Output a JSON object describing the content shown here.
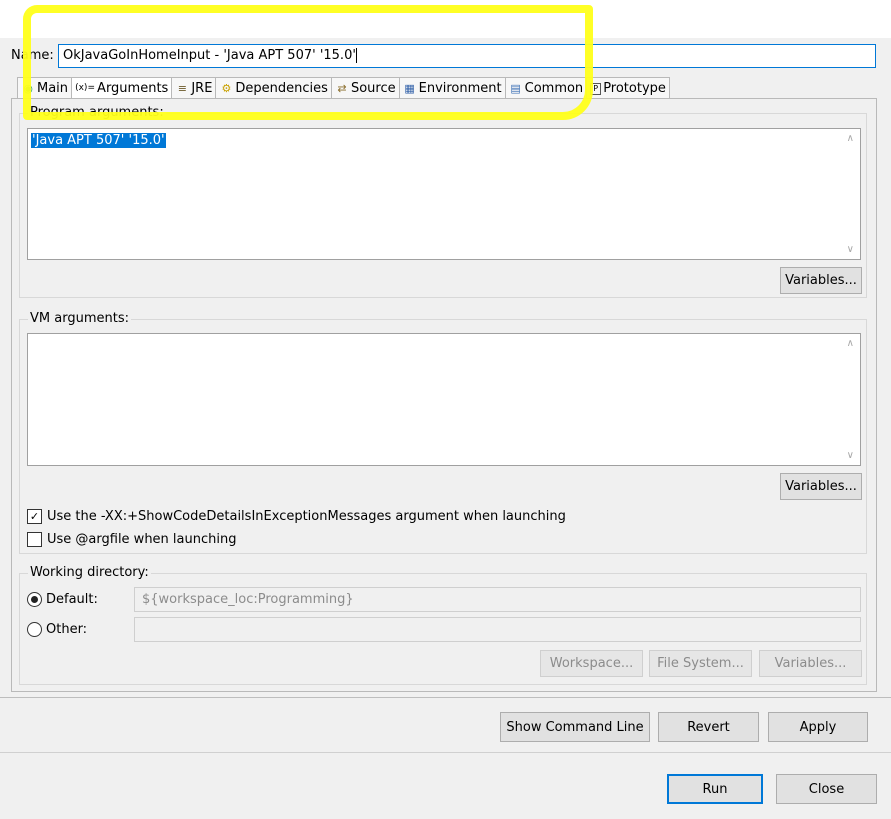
{
  "name_label": "Name:",
  "name_value": "OkJavaGoInHomeInput - 'Java APT 507' '15.0'",
  "tabs": [
    {
      "label": "Main",
      "icon": "main-icon"
    },
    {
      "label": "Arguments",
      "icon": "arguments-icon"
    },
    {
      "label": "JRE",
      "icon": "jre-icon"
    },
    {
      "label": "Dependencies",
      "icon": "dependencies-icon"
    },
    {
      "label": "Source",
      "icon": "source-icon"
    },
    {
      "label": "Environment",
      "icon": "environment-icon"
    },
    {
      "label": "Common",
      "icon": "common-icon"
    },
    {
      "label": "Prototype",
      "icon": "prototype-icon"
    }
  ],
  "program_args": {
    "label": "Program arguments:",
    "value": "'Java APT 507' '15.0'",
    "variables_button": "Variables..."
  },
  "vm_args": {
    "label": "VM arguments:",
    "value": "",
    "variables_button": "Variables..."
  },
  "checkboxes": [
    {
      "label": "Use the -XX:+ShowCodeDetailsInExceptionMessages argument when launching",
      "checked": true
    },
    {
      "label": "Use @argfile when launching",
      "checked": false
    }
  ],
  "working_dir": {
    "label": "Working directory:",
    "default_label": "Default:",
    "default_value": "${workspace_loc:Programming}",
    "other_label": "Other:",
    "other_value": "",
    "selected": "default",
    "workspace_button": "Workspace...",
    "filesystem_button": "File System...",
    "variables_button": "Variables..."
  },
  "actions": {
    "show_command_line": "Show Command Line",
    "revert": "Revert",
    "apply": "Apply",
    "run": "Run",
    "close": "Close"
  },
  "colors": {
    "highlight": "#ffff1a",
    "selection": "#0078d7"
  }
}
